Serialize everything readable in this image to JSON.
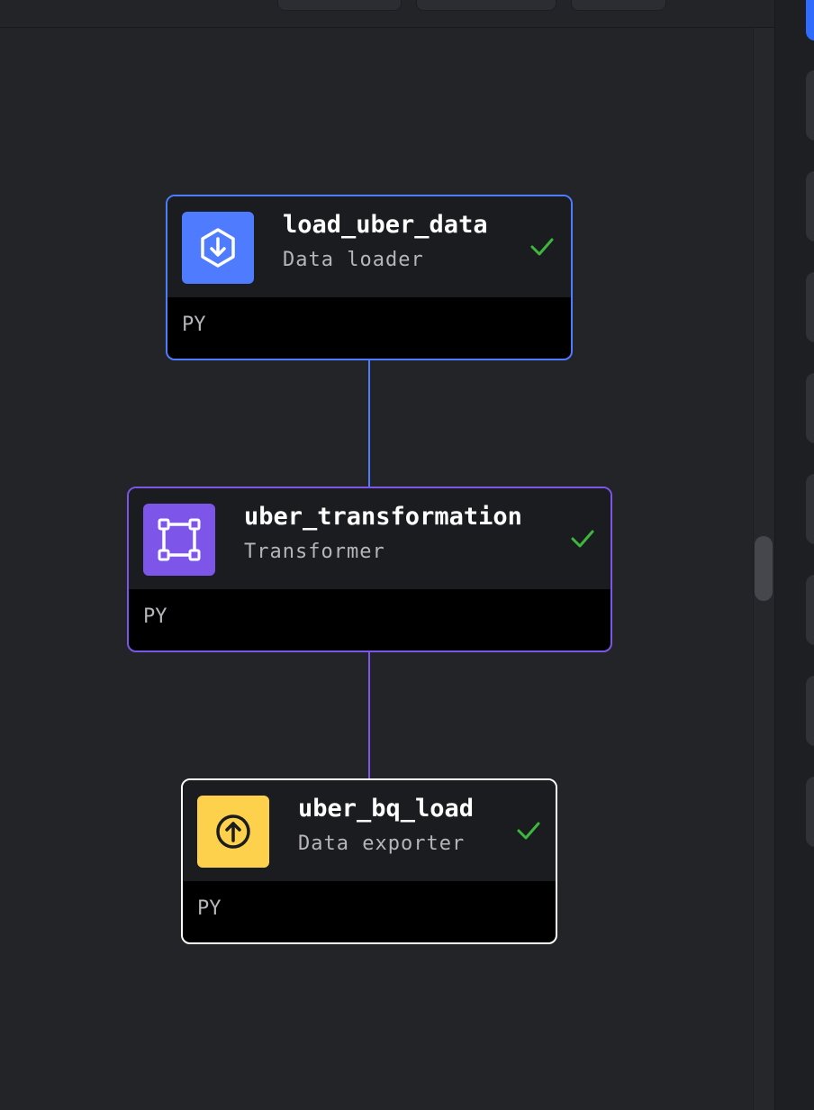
{
  "colors": {
    "canvas_bg": "#232428",
    "loader_accent": "#4f7bff",
    "transformer_accent": "#7d55e8",
    "exporter_accent": "#fdd14c",
    "exporter_border": "#ffffff",
    "success_check": "#3cb83c"
  },
  "blocks": [
    {
      "name": "load_uber_data",
      "type_label": "Data loader",
      "language": "PY",
      "icon": "download-hexagon-icon",
      "status": "success"
    },
    {
      "name": "uber_transformation",
      "type_label": "Transformer",
      "language": "PY",
      "icon": "transform-frame-icon",
      "status": "success"
    },
    {
      "name": "uber_bq_load",
      "type_label": "Data exporter",
      "language": "PY",
      "icon": "upload-circle-icon",
      "status": "success"
    }
  ]
}
